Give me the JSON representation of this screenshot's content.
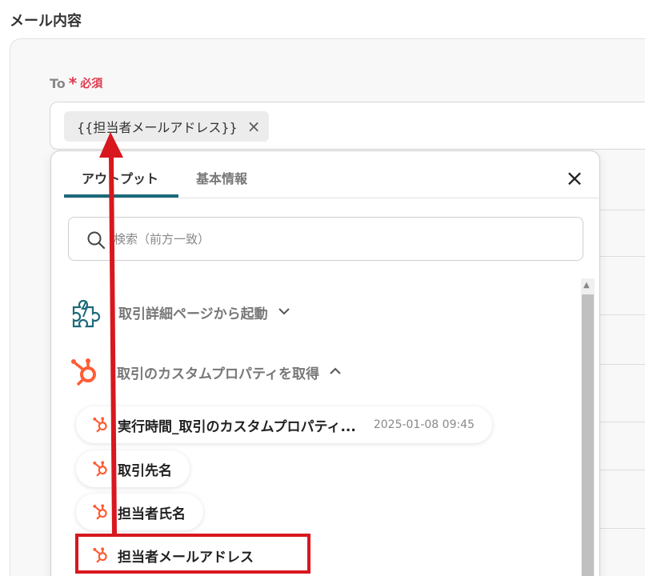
{
  "section": {
    "title": "メール内容"
  },
  "to_field": {
    "label": "To",
    "required_mark": "*",
    "required_text": "必須",
    "chip_text": "{{担当者メールアドレス}}",
    "chip_remove": "×"
  },
  "popover": {
    "tabs": [
      {
        "label": "アウトプット",
        "active": true
      },
      {
        "label": "基本情報",
        "active": false
      }
    ],
    "close_label": "×",
    "search": {
      "placeholder": "検索（前方一致）"
    },
    "groups": [
      {
        "label": "取引詳細ページから起動",
        "icon": "puzzle-icon",
        "expanded": false
      },
      {
        "label": "取引のカスタムプロパティを取得",
        "icon": "hubspot-icon",
        "expanded": true
      }
    ],
    "items": [
      {
        "label": "実行時間_取引のカスタムプロパティ...",
        "value": "2025-01-08 09:45"
      },
      {
        "label": "取引先名",
        "value": ""
      },
      {
        "label": "担当者氏名",
        "value": ""
      },
      {
        "label": "担当者メールアドレス",
        "value": ""
      }
    ]
  },
  "colors": {
    "accent_tab": "#1c6a7a",
    "required": "#e0394e",
    "hubspot": "#ff5c35",
    "annotation": "#d8171e"
  }
}
